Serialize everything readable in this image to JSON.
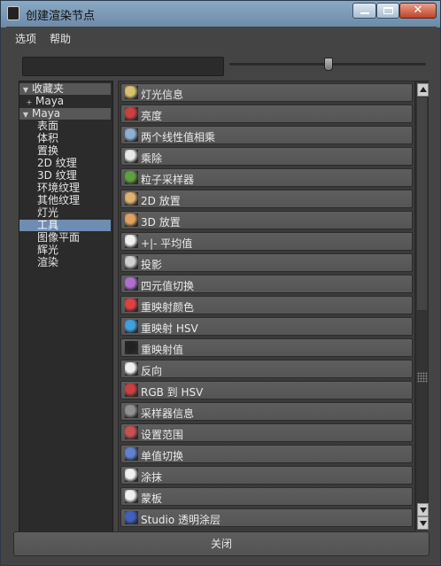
{
  "window": {
    "title": "创建渲染节点",
    "icon": "maya-app-icon",
    "buttons": {
      "minimize": "minimize-icon",
      "maximize": "maximize-icon",
      "close": "close-icon",
      "close_glyph": "✕"
    }
  },
  "menu": {
    "options": "选项",
    "help": "帮助"
  },
  "search": {
    "value": ""
  },
  "slider": {
    "level": 0.5
  },
  "tree": [
    {
      "label": "收藏夹",
      "kind": "header",
      "expanded": true
    },
    {
      "label": "Maya",
      "kind": "fav",
      "indent": 1
    },
    {
      "label": "Maya",
      "kind": "header",
      "expanded": true
    },
    {
      "label": "表面",
      "kind": "leaf"
    },
    {
      "label": "体积",
      "kind": "leaf"
    },
    {
      "label": "置换",
      "kind": "leaf"
    },
    {
      "label": "2D 纹理",
      "kind": "leaf"
    },
    {
      "label": "3D 纹理",
      "kind": "leaf"
    },
    {
      "label": "环境纹理",
      "kind": "leaf"
    },
    {
      "label": "其他纹理",
      "kind": "leaf"
    },
    {
      "label": "灯光",
      "kind": "leaf"
    },
    {
      "label": "工具",
      "kind": "leaf",
      "selected": true
    },
    {
      "label": "图像平面",
      "kind": "leaf"
    },
    {
      "label": "辉光",
      "kind": "leaf"
    },
    {
      "label": "渲染",
      "kind": "leaf"
    }
  ],
  "items": [
    {
      "label": "灯光信息",
      "icon": "light-info-icon",
      "color": "#d8c070"
    },
    {
      "label": "亮度",
      "icon": "luminance-icon",
      "color": "#c84040"
    },
    {
      "label": "两个线性值相乘",
      "icon": "multiply-divide-grid-icon",
      "color": "#8fb0d0"
    },
    {
      "label": "乘除",
      "icon": "multiply-divide-icon",
      "color": "#e8e8e8"
    },
    {
      "label": "粒子采样器",
      "icon": "particle-sampler-icon",
      "color": "#60a040"
    },
    {
      "label": "2D 放置",
      "icon": "place2d-icon",
      "color": "#e0b070"
    },
    {
      "label": "3D 放置",
      "icon": "place3d-icon",
      "color": "#e0a060"
    },
    {
      "label": "+|- 平均值",
      "icon": "plus-minus-average-icon",
      "color": "#f0f0f0"
    },
    {
      "label": "投影",
      "icon": "projection-icon",
      "color": "#d0d0d0"
    },
    {
      "label": "四元值切换",
      "icon": "quad-switch-icon",
      "color": "#b06fd0"
    },
    {
      "label": "重映射颜色",
      "icon": "remap-color-icon",
      "color": "#e04040"
    },
    {
      "label": "重映射 HSV",
      "icon": "remap-hsv-icon",
      "color": "#40a0e0"
    },
    {
      "label": "重映射值",
      "icon": "remap-value-icon",
      "color": "#222222"
    },
    {
      "label": "反向",
      "icon": "reverse-icon",
      "color": "#f0f0f0"
    },
    {
      "label": "RGB 到 HSV",
      "icon": "rgb-to-hsv-icon",
      "color": "#c84040"
    },
    {
      "label": "采样器信息",
      "icon": "sampler-info-icon",
      "color": "#909090"
    },
    {
      "label": "设置范围",
      "icon": "set-range-icon",
      "color": "#c85050"
    },
    {
      "label": "单值切换",
      "icon": "single-switch-icon",
      "color": "#6080d0"
    },
    {
      "label": "涂抹",
      "icon": "smear-icon",
      "color": "#f0f0f0"
    },
    {
      "label": "蒙板",
      "icon": "stencil-icon",
      "color": "#f0f0f0"
    },
    {
      "label": "Studio 透明涂层",
      "icon": "studio-clear-coat-icon",
      "color": "#4060c0"
    }
  ],
  "close_button": "关闭"
}
